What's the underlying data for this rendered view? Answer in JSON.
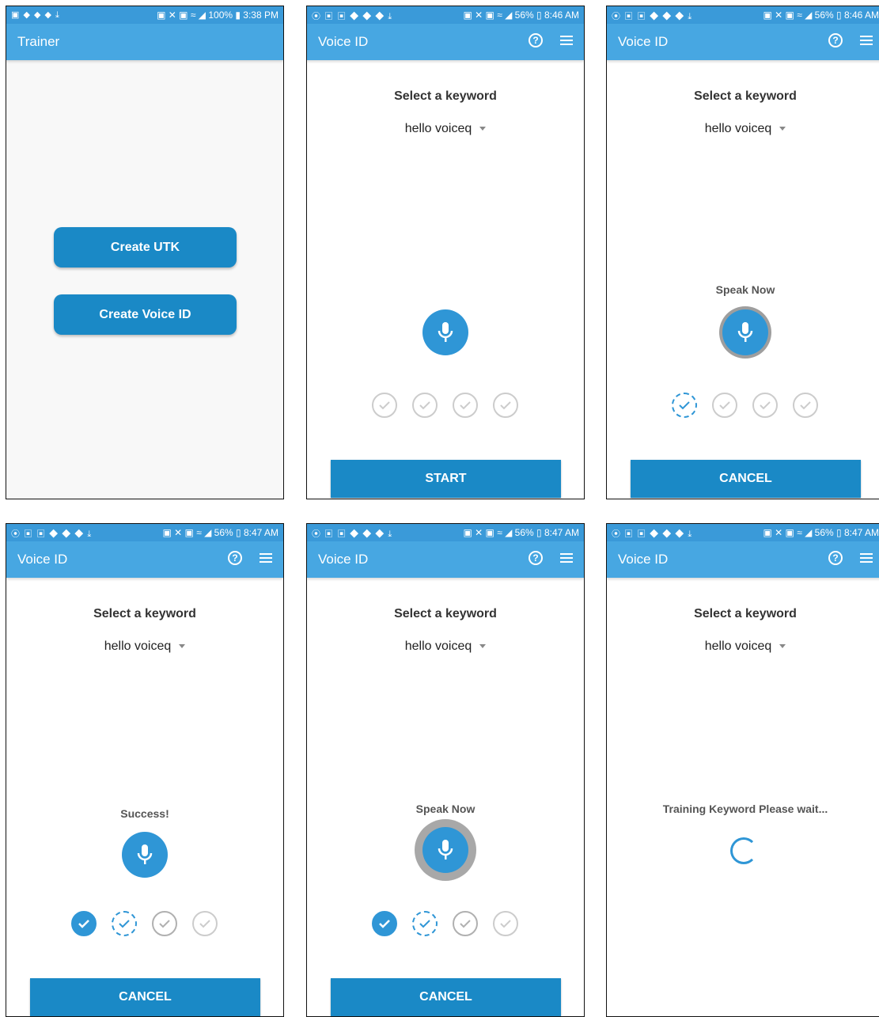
{
  "screens": [
    {
      "status_left": "▣ ◆ ◆ ◆ ⤓",
      "status_right": "▣ ✕ ▣ ≈ ◢ 100% ▮ 3:38 PM",
      "app_title": "Trainer",
      "buttons": [
        "Create UTK",
        "Create Voice ID"
      ]
    },
    {
      "status_left": "⦿ ▣ ▣ ◆ ◆ ◆ ⤓",
      "status_right": "▣ ✕ ▣ ≈ ◢ 56% ▯ 8:46 AM",
      "app_title": "Voice ID",
      "keyword_label": "Select a keyword",
      "keyword_value": "hello voiceq",
      "status_text": "",
      "checks": [
        "empty",
        "empty",
        "empty",
        "empty"
      ],
      "bottom_button": "START"
    },
    {
      "status_left": "⦿ ▣ ▣ ◆ ◆ ◆ ⤓",
      "status_right": "▣ ✕ ▣ ≈ ◢ 56% ▯ 8:46 AM",
      "app_title": "Voice ID",
      "keyword_label": "Select a keyword",
      "keyword_value": "hello voiceq",
      "status_text": "Speak Now",
      "checks": [
        "active",
        "empty",
        "empty",
        "empty"
      ],
      "bottom_button": "CANCEL"
    },
    {
      "status_left": "⦿ ▣ ▣ ◆ ◆ ◆ ⤓",
      "status_right": "▣ ✕ ▣ ≈ ◢ 56% ▯ 8:47 AM",
      "app_title": "Voice ID",
      "keyword_label": "Select a keyword",
      "keyword_value": "hello voiceq",
      "status_text": "Success!",
      "checks": [
        "done",
        "active",
        "empty",
        "empty"
      ],
      "bottom_button": "CANCEL"
    },
    {
      "status_left": "⦿ ▣ ▣ ◆ ◆ ◆ ⤓",
      "status_right": "▣ ✕ ▣ ≈ ◢ 56% ▯ 8:47 AM",
      "app_title": "Voice ID",
      "keyword_label": "Select a keyword",
      "keyword_value": "hello voiceq",
      "status_text": "Speak Now",
      "checks": [
        "done",
        "active",
        "empty",
        "empty"
      ],
      "bottom_button": "CANCEL"
    },
    {
      "status_left": "⦿ ▣ ▣ ◆ ◆ ◆ ⤓",
      "status_right": "▣ ✕ ▣ ≈ ◢ 56% ▯ 8:47 AM",
      "app_title": "Voice ID",
      "keyword_label": "Select a keyword",
      "keyword_value": "hello voiceq",
      "status_text": "Training Keyword Please wait...",
      "bottom_button": ""
    }
  ],
  "colors": {
    "appbar": "#47a7e2",
    "statusbar": "#3a9ad9",
    "primary": "#1a89c6",
    "mic": "#2f96d6",
    "check_empty": "#cccccc"
  }
}
